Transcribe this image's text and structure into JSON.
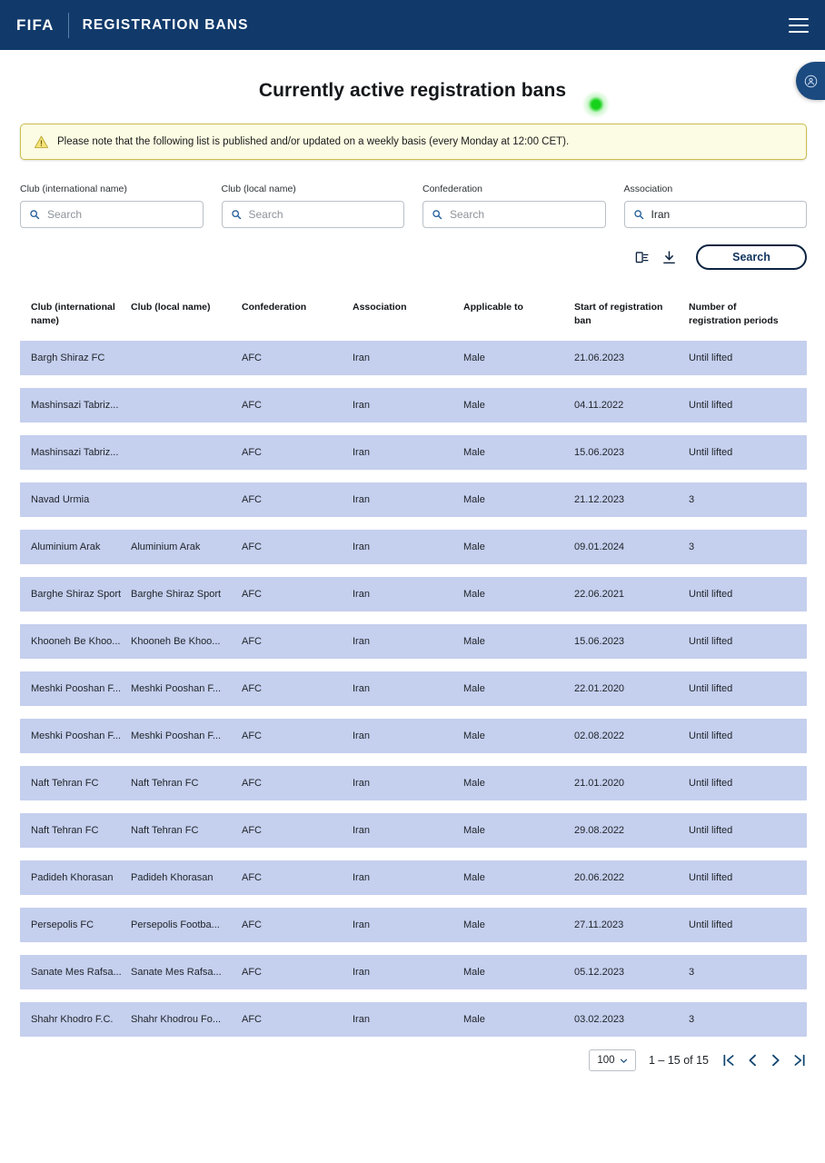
{
  "header": {
    "brand": "FIFA",
    "section_title": "REGISTRATION BANS",
    "menu_icon": "hamburger-menu-icon"
  },
  "feedback_tab": {
    "icon": "user-feedback-icon"
  },
  "main": {
    "page_title": "Currently active registration bans",
    "cursor_indicator": "green-click-dot",
    "notice": {
      "icon": "warning-triangle-icon",
      "text": "Please note that the following list is published and/or updated on a weekly basis (every Monday at 12:00 CET)."
    }
  },
  "filters": [
    {
      "label": "Club (international name)",
      "value": "",
      "placeholder": "Search",
      "icon": "search-icon"
    },
    {
      "label": "Club (local name)",
      "value": "",
      "placeholder": "Search",
      "icon": "search-icon"
    },
    {
      "label": "Confederation",
      "value": "",
      "placeholder": "Search",
      "icon": "search-icon"
    },
    {
      "label": "Association",
      "value": "Iran",
      "placeholder": "Search",
      "icon": "search-icon"
    }
  ],
  "actions": {
    "copy_icon": "copy-list-icon",
    "download_icon": "download-icon",
    "search_label": "Search"
  },
  "table": {
    "columns": [
      "Club (international name)",
      "Club (local name)",
      "Confederation",
      "Association",
      "Applicable to",
      "Start of registration ban",
      "Number of registration periods"
    ],
    "rows": [
      [
        "Bargh Shiraz FC",
        "",
        "AFC",
        "Iran",
        "Male",
        "21.06.2023",
        "Until lifted"
      ],
      [
        "Mashinsazi Tabriz...",
        "",
        "AFC",
        "Iran",
        "Male",
        "04.11.2022",
        "Until lifted"
      ],
      [
        "Mashinsazi Tabriz...",
        "",
        "AFC",
        "Iran",
        "Male",
        "15.06.2023",
        "Until lifted"
      ],
      [
        "Navad Urmia",
        "",
        "AFC",
        "Iran",
        "Male",
        "21.12.2023",
        "3"
      ],
      [
        "Aluminium Arak",
        "Aluminium Arak",
        "AFC",
        "Iran",
        "Male",
        "09.01.2024",
        "3"
      ],
      [
        "Barghe Shiraz Sport",
        "Barghe Shiraz Sport",
        "AFC",
        "Iran",
        "Male",
        "22.06.2021",
        "Until lifted"
      ],
      [
        "Khooneh Be Khoo...",
        "Khooneh Be Khoo...",
        "AFC",
        "Iran",
        "Male",
        "15.06.2023",
        "Until lifted"
      ],
      [
        "Meshki Pooshan F...",
        "Meshki Pooshan F...",
        "AFC",
        "Iran",
        "Male",
        "22.01.2020",
        "Until lifted"
      ],
      [
        "Meshki Pooshan F...",
        "Meshki Pooshan F...",
        "AFC",
        "Iran",
        "Male",
        "02.08.2022",
        "Until lifted"
      ],
      [
        "Naft Tehran FC",
        "Naft Tehran FC",
        "AFC",
        "Iran",
        "Male",
        "21.01.2020",
        "Until lifted"
      ],
      [
        "Naft Tehran FC",
        "Naft Tehran FC",
        "AFC",
        "Iran",
        "Male",
        "29.08.2022",
        "Until lifted"
      ],
      [
        "Padideh Khorasan",
        "Padideh Khorasan",
        "AFC",
        "Iran",
        "Male",
        "20.06.2022",
        "Until lifted"
      ],
      [
        "Persepolis FC",
        "Persepolis Footba...",
        "AFC",
        "Iran",
        "Male",
        "27.11.2023",
        "Until lifted"
      ],
      [
        "Sanate Mes Rafsa...",
        "Sanate Mes Rafsa...",
        "AFC",
        "Iran",
        "Male",
        "05.12.2023",
        "3"
      ],
      [
        "Shahr Khodro F.C.",
        "Shahr Khodrou Fo...",
        "AFC",
        "Iran",
        "Male",
        "03.02.2023",
        "3"
      ]
    ]
  },
  "pagination": {
    "page_size": "100",
    "range_text": "1 – 15 of 15",
    "first_icon": "first-page-icon",
    "prev_icon": "previous-page-icon",
    "next_icon": "next-page-icon",
    "last_icon": "last-page-icon"
  },
  "colors": {
    "header_navy": "#113a6b",
    "row_lavender": "#c5cfee",
    "notice_bg": "#fcfbe3",
    "notice_border": "#c9bd4e",
    "accent_dark": "#0c2340",
    "cursor_green": "#16d21a"
  }
}
